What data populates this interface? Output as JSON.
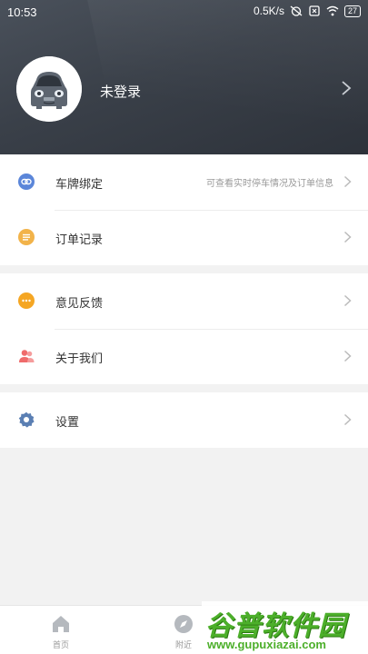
{
  "status_bar": {
    "time": "10:53",
    "network_speed": "0.5K/s",
    "battery": "27"
  },
  "profile": {
    "login_label": "未登录"
  },
  "menu_groups": [
    {
      "items": [
        {
          "label": "车牌绑定",
          "hint": "可查看实时停车情况及订单信息",
          "icon": "link-icon",
          "color": "#5b86d9"
        },
        {
          "label": "订单记录",
          "hint": "",
          "icon": "order-list-icon",
          "color": "#f2b34a"
        }
      ]
    },
    {
      "items": [
        {
          "label": "意见反馈",
          "hint": "",
          "icon": "feedback-icon",
          "color": "#f5a623"
        },
        {
          "label": "关于我们",
          "hint": "",
          "icon": "people-icon",
          "color": "#ef6b6b"
        }
      ]
    },
    {
      "items": [
        {
          "label": "设置",
          "hint": "",
          "icon": "gear-icon",
          "color": "#5b7fb3"
        }
      ]
    }
  ],
  "tabbar": {
    "tabs": [
      {
        "label": "首页",
        "icon": "home-icon"
      },
      {
        "label": "附近",
        "icon": "compass-icon"
      }
    ]
  },
  "watermark": {
    "title": "谷普软件园",
    "url": "www.gupuxiazai.com"
  }
}
